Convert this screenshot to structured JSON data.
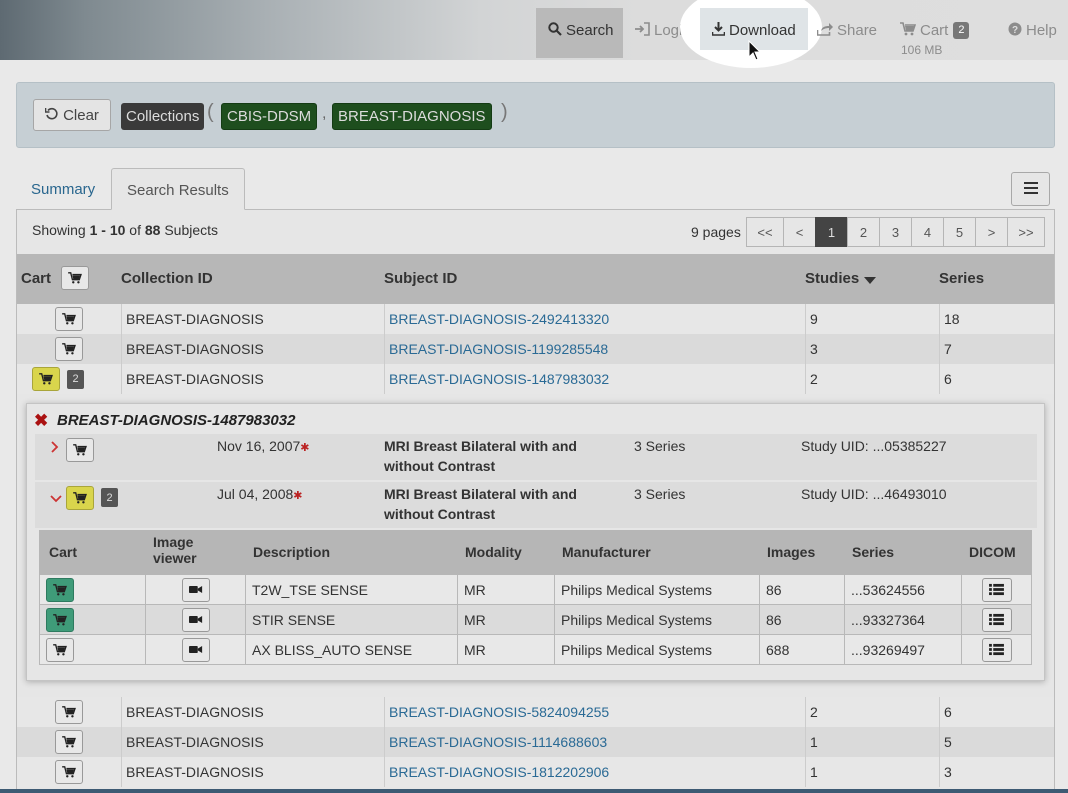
{
  "nav": {
    "search": "Search",
    "login": "Login",
    "download": "Download",
    "share": "Share",
    "cart": "Cart",
    "cart_count": "2",
    "cart_size": "106 MB",
    "help": "Help"
  },
  "filters": {
    "clear": "Clear",
    "collections_label": "Collections",
    "open_paren": "(",
    "comma": ",",
    "close_paren": ")",
    "collections": [
      "CBIS-DDSM",
      "BREAST-DIAGNOSIS"
    ]
  },
  "tabs": {
    "summary": "Summary",
    "results": "Search Results"
  },
  "results": {
    "showing_prefix": "Showing ",
    "range": "1 - 10",
    "of": " of ",
    "total": "88",
    "suffix": " Subjects",
    "pages_label": "9 pages",
    "pager": [
      "<<",
      "<",
      "1",
      "2",
      "3",
      "4",
      "5",
      ">",
      ">>"
    ]
  },
  "table": {
    "headers": {
      "cart": "Cart",
      "collection": "Collection ID",
      "subject": "Subject ID",
      "studies": "Studies",
      "series": "Series"
    },
    "rows_top": [
      {
        "collection": "BREAST-DIAGNOSIS",
        "subject": "BREAST-DIAGNOSIS-2492413320",
        "studies": "9",
        "series": "18"
      },
      {
        "collection": "BREAST-DIAGNOSIS",
        "subject": "BREAST-DIAGNOSIS-1199285548",
        "studies": "3",
        "series": "7"
      },
      {
        "collection": "BREAST-DIAGNOSIS",
        "subject": "BREAST-DIAGNOSIS-1487983032",
        "studies": "2",
        "series": "6",
        "badge": "2"
      }
    ],
    "rows_bottom": [
      {
        "collection": "BREAST-DIAGNOSIS",
        "subject": "BREAST-DIAGNOSIS-5824094255",
        "studies": "2",
        "series": "6"
      },
      {
        "collection": "BREAST-DIAGNOSIS",
        "subject": "BREAST-DIAGNOSIS-1114688603",
        "studies": "1",
        "series": "5"
      },
      {
        "collection": "BREAST-DIAGNOSIS",
        "subject": "BREAST-DIAGNOSIS-1812202906",
        "studies": "1",
        "series": "3"
      }
    ]
  },
  "detail": {
    "title": "BREAST-DIAGNOSIS-1487983032",
    "studies": [
      {
        "date": "Nov 16, 2007",
        "desc1": "MRI Breast Bilateral with and",
        "desc2": "without Contrast",
        "series": "3 Series",
        "uid": "Study UID: ...05385227"
      },
      {
        "date": "Jul 04, 2008",
        "desc1": "MRI Breast Bilateral with and",
        "desc2": "without Contrast",
        "series": "3 Series",
        "uid": "Study UID: ...46493010",
        "badge": "2"
      }
    ],
    "series_headers": {
      "cart": "Cart",
      "viewer1": "Image",
      "viewer2": "viewer",
      "description": "Description",
      "modality": "Modality",
      "manufacturer": "Manufacturer",
      "images": "Images",
      "series": "Series",
      "dicom": "DICOM"
    },
    "series_rows": [
      {
        "description": "T2W_TSE SENSE",
        "modality": "MR",
        "manufacturer": "Philips Medical Systems",
        "images": "86",
        "series": "...53624556",
        "in_cart": true
      },
      {
        "description": "STIR SENSE",
        "modality": "MR",
        "manufacturer": "Philips Medical Systems",
        "images": "86",
        "series": "...93327364",
        "in_cart": true
      },
      {
        "description": "AX BLISS_AUTO SENSE",
        "modality": "MR",
        "manufacturer": "Philips Medical Systems",
        "images": "688",
        "series": "...93269497",
        "in_cart": false
      }
    ]
  },
  "colors": {
    "link": "#2a6a95",
    "in_cart_yellow": "#d9d54c",
    "in_cart_series": "#3f9b79",
    "collection_tag": "#1e4e1e"
  },
  "icons": [
    "search-icon",
    "login-icon",
    "download-icon",
    "share-icon",
    "cart-icon",
    "help-icon",
    "clear-icon",
    "menu-icon",
    "video-icon",
    "list-icon",
    "close-icon",
    "chevron-right-icon",
    "chevron-down-icon",
    "sort-desc-icon"
  ]
}
